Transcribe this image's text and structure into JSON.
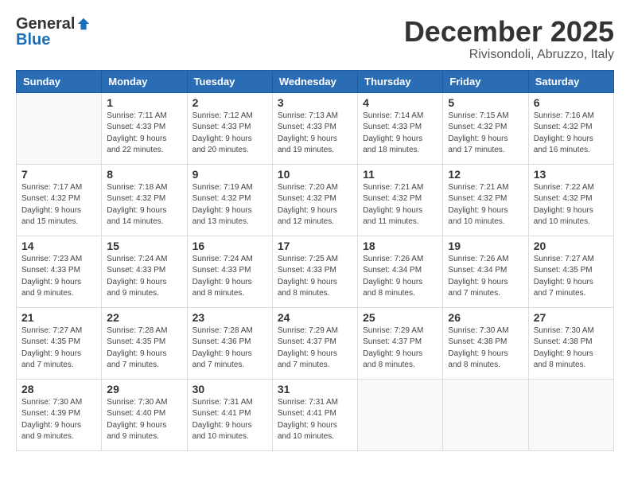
{
  "logo": {
    "general": "General",
    "blue": "Blue"
  },
  "title": "December 2025",
  "subtitle": "Rivisondoli, Abruzzo, Italy",
  "days_of_week": [
    "Sunday",
    "Monday",
    "Tuesday",
    "Wednesday",
    "Thursday",
    "Friday",
    "Saturday"
  ],
  "weeks": [
    [
      {
        "day": "",
        "info": ""
      },
      {
        "day": "1",
        "info": "Sunrise: 7:11 AM\nSunset: 4:33 PM\nDaylight: 9 hours\nand 22 minutes."
      },
      {
        "day": "2",
        "info": "Sunrise: 7:12 AM\nSunset: 4:33 PM\nDaylight: 9 hours\nand 20 minutes."
      },
      {
        "day": "3",
        "info": "Sunrise: 7:13 AM\nSunset: 4:33 PM\nDaylight: 9 hours\nand 19 minutes."
      },
      {
        "day": "4",
        "info": "Sunrise: 7:14 AM\nSunset: 4:33 PM\nDaylight: 9 hours\nand 18 minutes."
      },
      {
        "day": "5",
        "info": "Sunrise: 7:15 AM\nSunset: 4:32 PM\nDaylight: 9 hours\nand 17 minutes."
      },
      {
        "day": "6",
        "info": "Sunrise: 7:16 AM\nSunset: 4:32 PM\nDaylight: 9 hours\nand 16 minutes."
      }
    ],
    [
      {
        "day": "7",
        "info": "Sunrise: 7:17 AM\nSunset: 4:32 PM\nDaylight: 9 hours\nand 15 minutes."
      },
      {
        "day": "8",
        "info": "Sunrise: 7:18 AM\nSunset: 4:32 PM\nDaylight: 9 hours\nand 14 minutes."
      },
      {
        "day": "9",
        "info": "Sunrise: 7:19 AM\nSunset: 4:32 PM\nDaylight: 9 hours\nand 13 minutes."
      },
      {
        "day": "10",
        "info": "Sunrise: 7:20 AM\nSunset: 4:32 PM\nDaylight: 9 hours\nand 12 minutes."
      },
      {
        "day": "11",
        "info": "Sunrise: 7:21 AM\nSunset: 4:32 PM\nDaylight: 9 hours\nand 11 minutes."
      },
      {
        "day": "12",
        "info": "Sunrise: 7:21 AM\nSunset: 4:32 PM\nDaylight: 9 hours\nand 10 minutes."
      },
      {
        "day": "13",
        "info": "Sunrise: 7:22 AM\nSunset: 4:32 PM\nDaylight: 9 hours\nand 10 minutes."
      }
    ],
    [
      {
        "day": "14",
        "info": "Sunrise: 7:23 AM\nSunset: 4:33 PM\nDaylight: 9 hours\nand 9 minutes."
      },
      {
        "day": "15",
        "info": "Sunrise: 7:24 AM\nSunset: 4:33 PM\nDaylight: 9 hours\nand 9 minutes."
      },
      {
        "day": "16",
        "info": "Sunrise: 7:24 AM\nSunset: 4:33 PM\nDaylight: 9 hours\nand 8 minutes."
      },
      {
        "day": "17",
        "info": "Sunrise: 7:25 AM\nSunset: 4:33 PM\nDaylight: 9 hours\nand 8 minutes."
      },
      {
        "day": "18",
        "info": "Sunrise: 7:26 AM\nSunset: 4:34 PM\nDaylight: 9 hours\nand 8 minutes."
      },
      {
        "day": "19",
        "info": "Sunrise: 7:26 AM\nSunset: 4:34 PM\nDaylight: 9 hours\nand 7 minutes."
      },
      {
        "day": "20",
        "info": "Sunrise: 7:27 AM\nSunset: 4:35 PM\nDaylight: 9 hours\nand 7 minutes."
      }
    ],
    [
      {
        "day": "21",
        "info": "Sunrise: 7:27 AM\nSunset: 4:35 PM\nDaylight: 9 hours\nand 7 minutes."
      },
      {
        "day": "22",
        "info": "Sunrise: 7:28 AM\nSunset: 4:35 PM\nDaylight: 9 hours\nand 7 minutes."
      },
      {
        "day": "23",
        "info": "Sunrise: 7:28 AM\nSunset: 4:36 PM\nDaylight: 9 hours\nand 7 minutes."
      },
      {
        "day": "24",
        "info": "Sunrise: 7:29 AM\nSunset: 4:37 PM\nDaylight: 9 hours\nand 7 minutes."
      },
      {
        "day": "25",
        "info": "Sunrise: 7:29 AM\nSunset: 4:37 PM\nDaylight: 9 hours\nand 8 minutes."
      },
      {
        "day": "26",
        "info": "Sunrise: 7:30 AM\nSunset: 4:38 PM\nDaylight: 9 hours\nand 8 minutes."
      },
      {
        "day": "27",
        "info": "Sunrise: 7:30 AM\nSunset: 4:38 PM\nDaylight: 9 hours\nand 8 minutes."
      }
    ],
    [
      {
        "day": "28",
        "info": "Sunrise: 7:30 AM\nSunset: 4:39 PM\nDaylight: 9 hours\nand 9 minutes."
      },
      {
        "day": "29",
        "info": "Sunrise: 7:30 AM\nSunset: 4:40 PM\nDaylight: 9 hours\nand 9 minutes."
      },
      {
        "day": "30",
        "info": "Sunrise: 7:31 AM\nSunset: 4:41 PM\nDaylight: 9 hours\nand 10 minutes."
      },
      {
        "day": "31",
        "info": "Sunrise: 7:31 AM\nSunset: 4:41 PM\nDaylight: 9 hours\nand 10 minutes."
      },
      {
        "day": "",
        "info": ""
      },
      {
        "day": "",
        "info": ""
      },
      {
        "day": "",
        "info": ""
      }
    ]
  ]
}
